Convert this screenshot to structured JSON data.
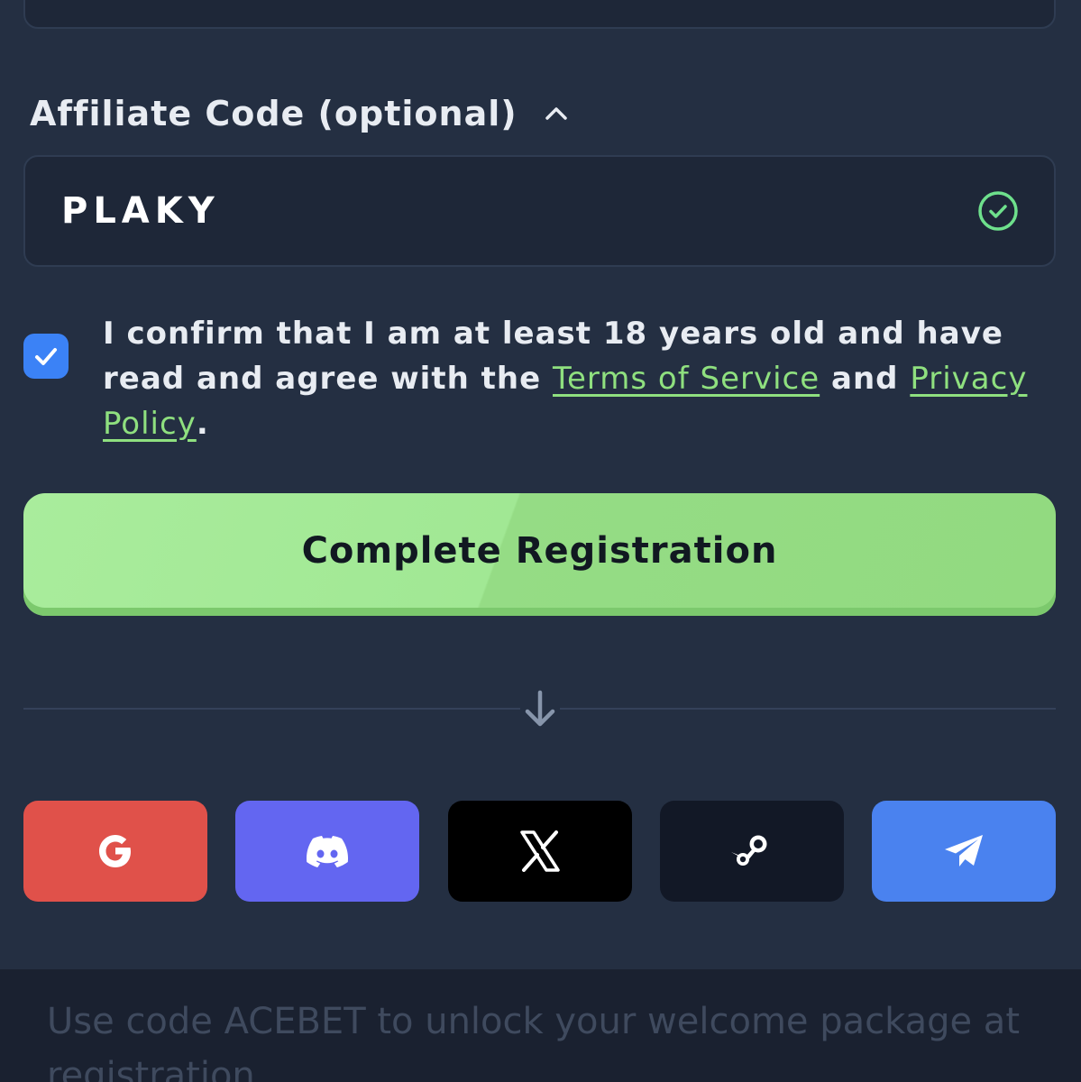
{
  "affiliate": {
    "label": "Affiliate Code (optional)",
    "value": "PLAKY",
    "valid": true
  },
  "consent": {
    "checked": true,
    "text_before": "I confirm that I am at least 18 years old and have read and agree with the ",
    "terms_link": "Terms of Service",
    "text_middle": " and ",
    "privacy_link": "Privacy Policy",
    "text_after": "."
  },
  "cta": {
    "label": "Complete Registration"
  },
  "socials": [
    {
      "name": "google",
      "icon": "google-icon",
      "color": "#e0514a"
    },
    {
      "name": "discord",
      "icon": "discord-icon",
      "color": "#6366f1"
    },
    {
      "name": "x",
      "icon": "x-icon",
      "color": "#000000"
    },
    {
      "name": "steam",
      "icon": "steam-icon",
      "color": "#121826"
    },
    {
      "name": "telegram",
      "icon": "telegram-icon",
      "color": "#4a82ef"
    }
  ],
  "footer": {
    "text": "Use code ACEBET to unlock your welcome package at registration"
  },
  "colors": {
    "background": "#242f42",
    "accent_green": "#a1e894",
    "link_green": "#8fe07f",
    "checkbox_blue": "#3b82f6",
    "valid_green": "#6ee08c"
  }
}
